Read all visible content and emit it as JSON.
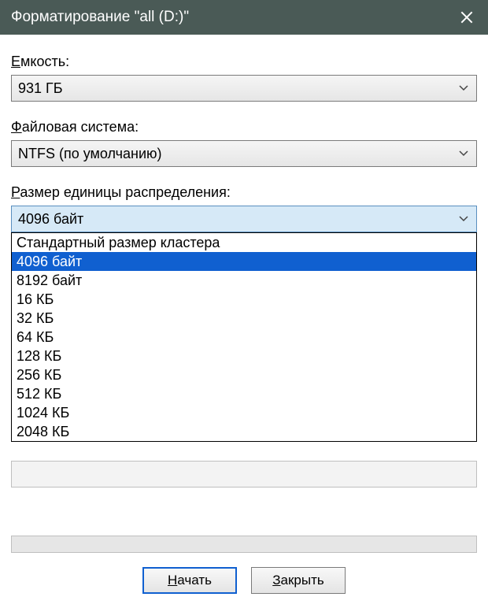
{
  "title": "Форматирование \"all (D:)\"",
  "labels": {
    "capacity_prefix": "Е",
    "capacity_rest": "мкость:",
    "filesystem_prefix": "Ф",
    "filesystem_rest": "айловая система:",
    "allocation_prefix": "Р",
    "allocation_rest": "азмер единицы распределения:"
  },
  "capacity": {
    "value": "931 ГБ"
  },
  "filesystem": {
    "value": "NTFS (по умолчанию)"
  },
  "allocation": {
    "value": "4096 байт",
    "options": [
      "Стандартный размер кластера",
      "4096 байт",
      "8192 байт",
      "16 КБ",
      "32 КБ",
      "64 КБ",
      "128 КБ",
      "256 КБ",
      "512 КБ",
      "1024 КБ",
      "2048 КБ"
    ],
    "selected_index": 1
  },
  "buttons": {
    "start_prefix": "Н",
    "start_rest": "ачать",
    "close_prefix": "З",
    "close_rest": "акрыть"
  }
}
